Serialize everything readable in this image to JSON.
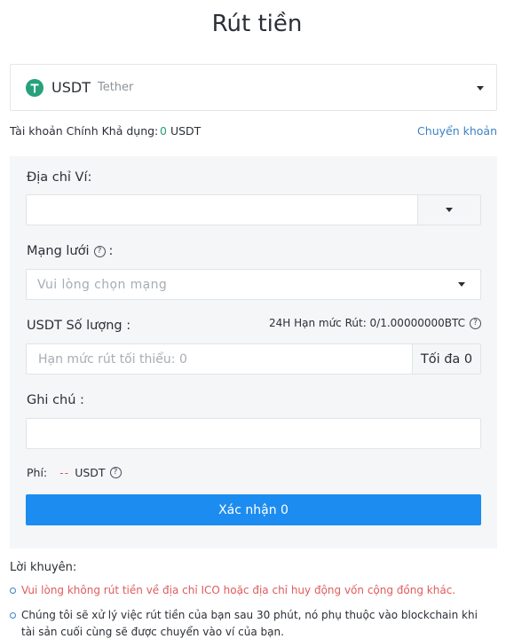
{
  "page": {
    "title": "Rút tiền"
  },
  "coin": {
    "symbol": "USDT",
    "name": "Tether",
    "icon": "tether-icon",
    "icon_color": "#26a17b"
  },
  "balance": {
    "label": "Tài khoản Chính Khả dụng:",
    "amount": "0",
    "unit": "USDT"
  },
  "transfer_link": "Chuyển khoản",
  "form": {
    "address_label": "Địa chỉ Ví:",
    "network_label": "Mạng lưới",
    "network_label_suffix": ":",
    "network_placeholder": "Vui lòng chọn mạng",
    "quantity_label": "USDT Số lượng :",
    "daily_limit": "24H Hạn mức Rút: 0/1.00000000BTC",
    "quantity_placeholder": "Hạn mức rút tối thiểu: 0",
    "max_label": "Tối đa 0",
    "memo_label": "Ghi chú :",
    "fee_label": "Phí:",
    "fee_value": "--",
    "fee_unit": "USDT",
    "confirm_label": "Xác nhận 0"
  },
  "tips": {
    "title": "Lời khuyên:",
    "items": [
      "Vui lòng không rút tiền về địa chỉ ICO hoặc địa chỉ huy động vốn cộng đồng khác.",
      "Chúng tôi sẽ xử lý việc rút tiền của bạn sau 30 phút, nó phụ thuộc vào blockchain khi tài sản cuối cùng sẽ được chuyển vào ví của bạn."
    ]
  },
  "colors": {
    "accent": "#1d8cf0",
    "link": "#3b82c4",
    "warning": "#e05b5b",
    "positive": "#26a17b"
  }
}
